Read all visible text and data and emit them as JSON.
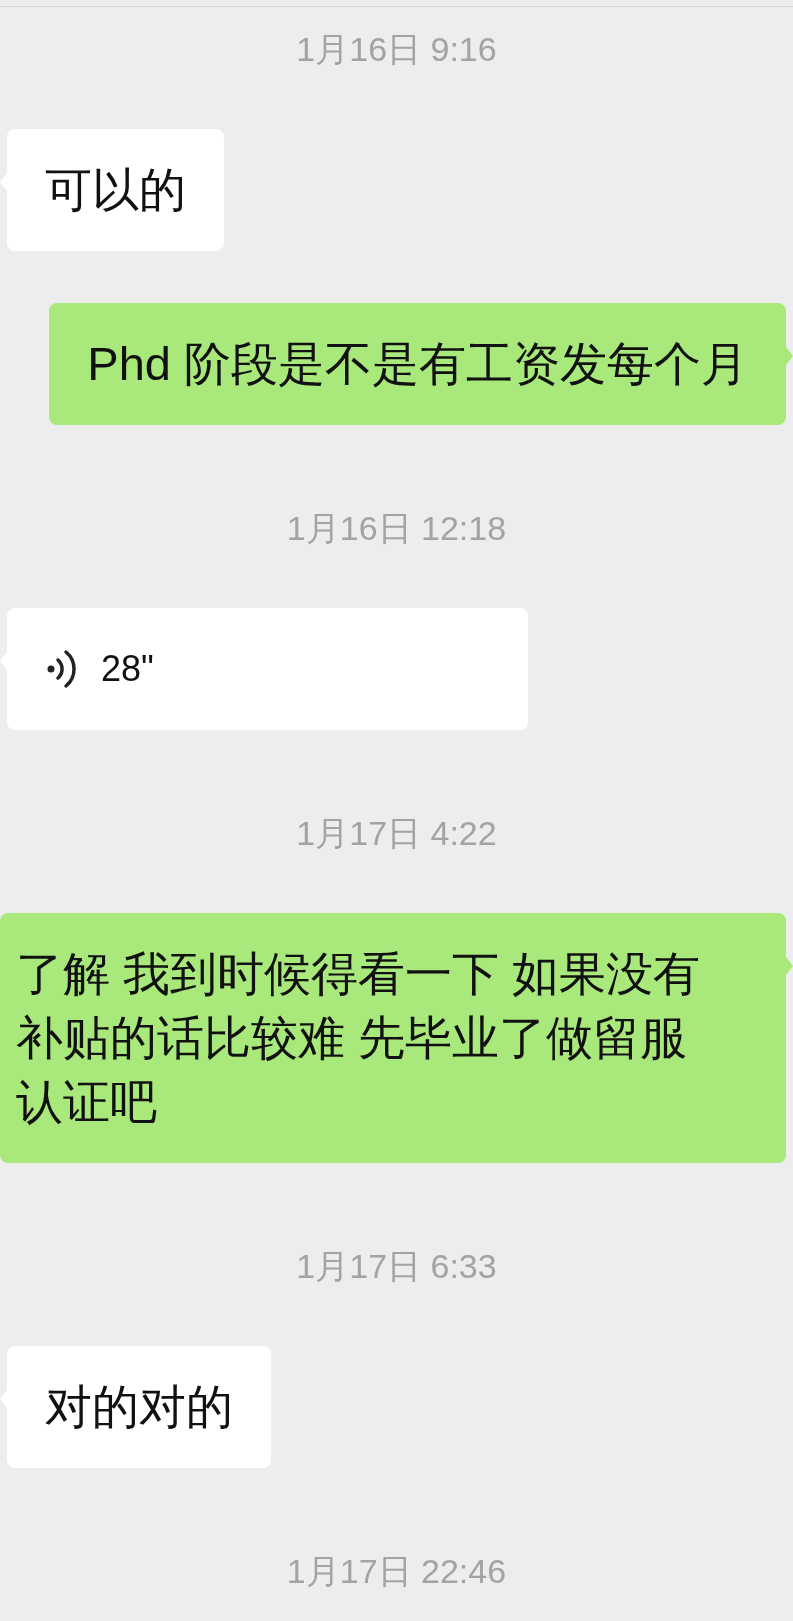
{
  "items": [
    {
      "kind": "timestamp",
      "text": "1月16日 9:16"
    },
    {
      "kind": "text",
      "from_me": false,
      "text": "可以的"
    },
    {
      "kind": "text",
      "from_me": true,
      "text": "Phd 阶段是不是有工资发每个月"
    },
    {
      "kind": "timestamp",
      "text": "1月16日 12:18"
    },
    {
      "kind": "voice",
      "from_me": false,
      "duration": "28\""
    },
    {
      "kind": "timestamp",
      "text": "1月17日 4:22"
    },
    {
      "kind": "text",
      "from_me": true,
      "text": "了解 我到时候得看一下 如果没有补贴的话比较难 先毕业了做留服认证吧"
    },
    {
      "kind": "timestamp",
      "text": "1月17日 6:33"
    },
    {
      "kind": "text",
      "from_me": false,
      "text": "对的对的"
    },
    {
      "kind": "timestamp",
      "text": "1月17日 22:46"
    }
  ]
}
